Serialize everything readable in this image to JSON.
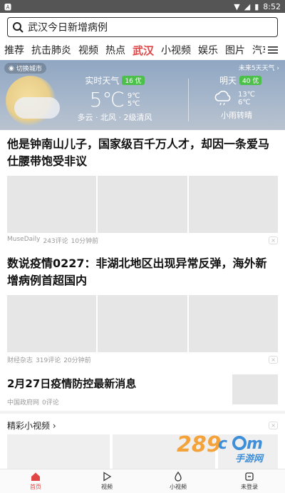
{
  "status_bar": {
    "left_icon": "notification-a-icon",
    "time": "8:52"
  },
  "search": {
    "value": "武汉今日新增病例"
  },
  "tabs": [
    {
      "label": "推荐"
    },
    {
      "label": "抗击肺炎"
    },
    {
      "label": "视频"
    },
    {
      "label": "热点"
    },
    {
      "label": "武汉",
      "active": true
    },
    {
      "label": "小视频"
    },
    {
      "label": "娱乐"
    },
    {
      "label": "图片"
    },
    {
      "label": "汽车"
    }
  ],
  "weather": {
    "city_switch": "切换城市",
    "future": "未来5天天气 ›",
    "now": {
      "title": "实时天气",
      "aqi": "16 优",
      "temp": "5℃",
      "high": "9℃",
      "low": "5℃",
      "desc": "多云 · 北风 · 2级清风"
    },
    "tomorrow": {
      "title": "明天",
      "aqi": "40 优",
      "high": "13℃",
      "low": "6℃",
      "desc": "小雨转晴"
    },
    "colors": {
      "aqi_good": "#4cc04a"
    }
  },
  "articles": [
    {
      "title": "他是钟南山儿子，国家级百千万人才，却因一条爱马仕腰带饱受非议",
      "source": "MuseDaily",
      "comments": "243评论",
      "time": "10分钟前"
    },
    {
      "title": "数说疫情0227：非湖北地区出现异常反弹，海外新增病例首超国内",
      "source": "财经杂志",
      "comments": "319评论",
      "time": "20分钟前"
    },
    {
      "title": "2月27日疫情防控最新消息",
      "source": "中国政府网",
      "comments": "0评论"
    }
  ],
  "videos_section": {
    "title": "精彩小视频 ›"
  },
  "watermark": {
    "text": "289手游网"
  },
  "bottom_nav": [
    {
      "label": "首页",
      "icon": "home-icon",
      "active": true
    },
    {
      "label": "视频",
      "icon": "play-icon"
    },
    {
      "label": "小视频",
      "icon": "short-video-icon"
    },
    {
      "label": "未登录",
      "icon": "user-icon"
    }
  ],
  "accent_color": "#e04646"
}
